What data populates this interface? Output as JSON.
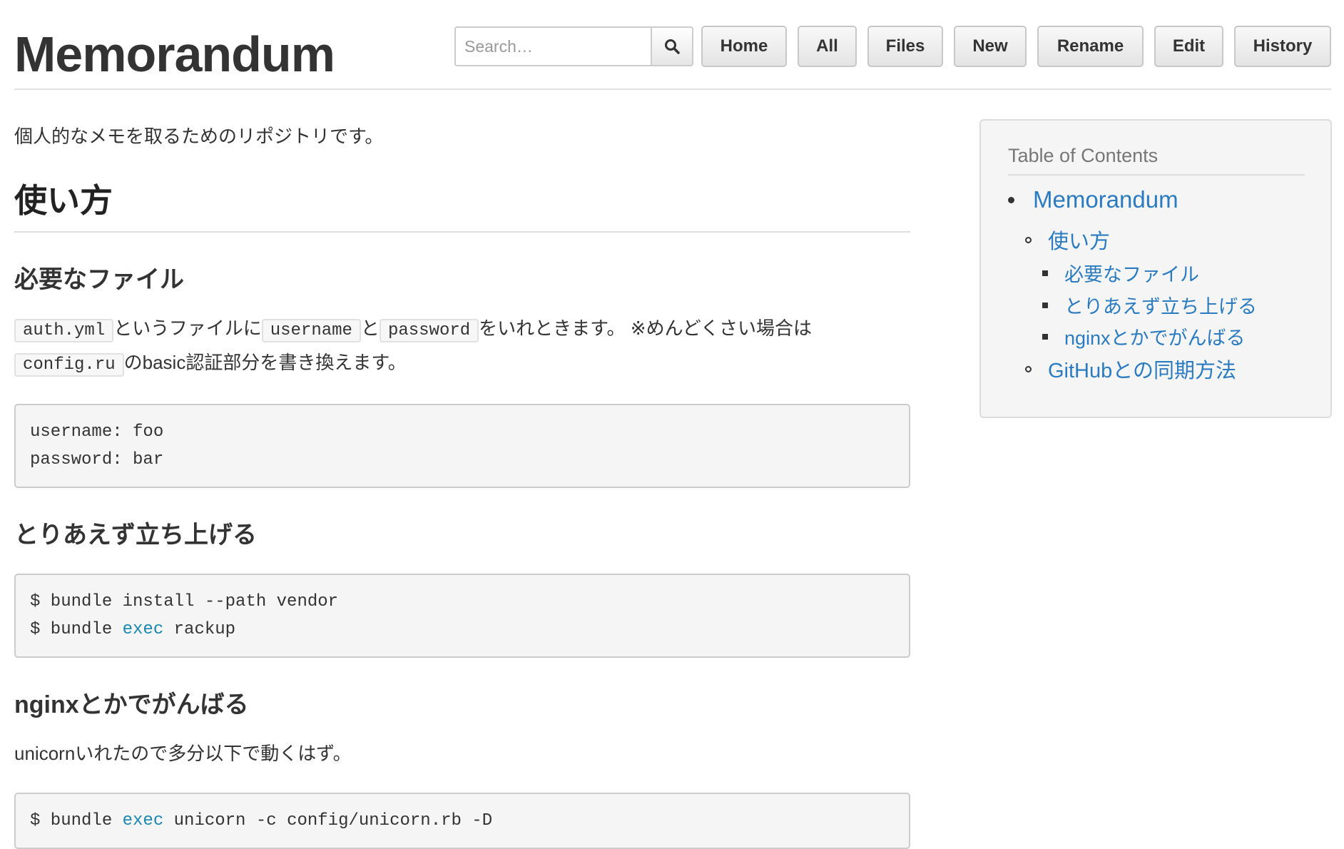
{
  "header": {
    "title": "Memorandum",
    "search_placeholder": "Search…",
    "nav": [
      "Home",
      "All",
      "Files",
      "New",
      "Rename",
      "Edit",
      "History"
    ]
  },
  "content": {
    "intro": "個人的なメモを取るためのリポジトリです。",
    "h1": "使い方",
    "sec1": {
      "title": "必要なファイル",
      "code_auth": "auth.yml",
      "t1": "というファイルに",
      "code_user": "username",
      "t2": "と",
      "code_pass": "password",
      "t3": "をいれときます。 ※めんどくさい場合は",
      "code_config": "config.ru",
      "t4": "のbasic認証部分を書き換えます。",
      "block_line1": "username: foo",
      "block_line2": "password: bar"
    },
    "sec2": {
      "title": "とりあえず立ち上げる",
      "line1": "$ bundle install --path vendor",
      "line2_a": "$ bundle ",
      "line2_kw": "exec",
      "line2_b": " rackup"
    },
    "sec3": {
      "title": "nginxとかでがんばる",
      "text": "unicornいれたので多分以下で動くはず。",
      "line1_a": "$ bundle ",
      "line1_kw": "exec",
      "line1_b": " unicorn -c config/unicorn.rb -D"
    }
  },
  "toc": {
    "title": "Table of Contents",
    "items": [
      {
        "label": "Memorandum"
      },
      {
        "label": "使い方"
      },
      {
        "label": "必要なファイル"
      },
      {
        "label": "とりあえず立ち上げる"
      },
      {
        "label": "nginxとかでがんばる"
      },
      {
        "label": "GitHubとの同期方法"
      }
    ]
  },
  "colors": {
    "link": "#2a7bc0",
    "code_keyword": "#1b88b0",
    "code_bg": "#f5f5f5"
  },
  "icons": {
    "search": "search-icon"
  }
}
